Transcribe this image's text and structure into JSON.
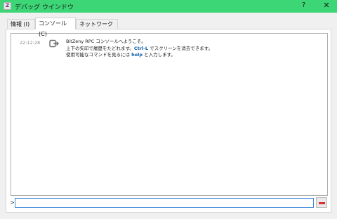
{
  "window": {
    "title": "デバッグ ウインドウ",
    "help_label": "?",
    "close_label": "✕",
    "icon_name": "bitzeny-logo"
  },
  "tabs": [
    {
      "label": "情報 (I)",
      "active": false
    },
    {
      "label": "コンソール (C)",
      "active": true
    },
    {
      "label": "ネットワーク (N)",
      "active": false
    }
  ],
  "console": {
    "messages": [
      {
        "time": "22:12:28",
        "icon": "console-output-icon",
        "line1": "BitZeny RPC コンソールへようこそ。",
        "line2_pre": "上下の矢印で履歴をたどれます。",
        "line2_key": "Ctrl-L",
        "line2_post": " でスクリーンを消去できます。",
        "line3_pre": "使用可能なコマンドを見るには ",
        "line3_key": "help",
        "line3_post": " と入力します。"
      }
    ],
    "prompt": ">",
    "input_value": "",
    "clear_icon": "clear-console-icon"
  },
  "colors": {
    "titlebar": "#3cd676",
    "keyword": "#0b5fa6",
    "input_focus": "#3d87d8",
    "clear_button": "#d93030"
  }
}
